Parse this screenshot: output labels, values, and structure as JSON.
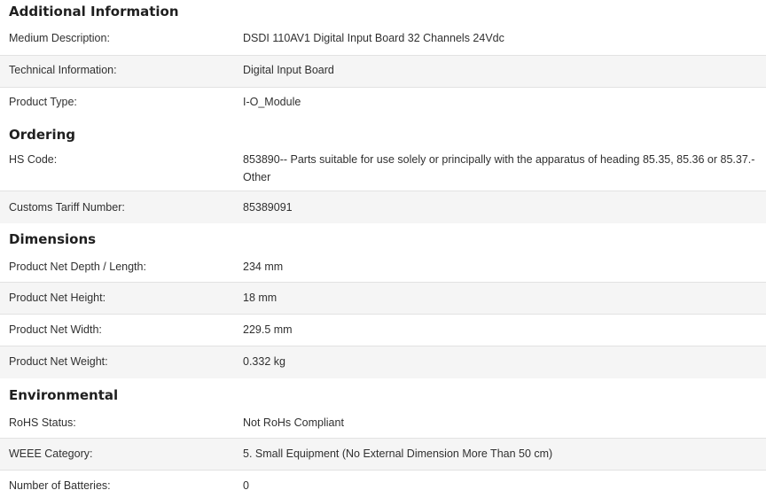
{
  "sections": [
    {
      "title": "Additional Information",
      "rows": [
        {
          "label": "Medium Description:",
          "value": "DSDI 110AV1 Digital Input Board 32 Channels 24Vdc"
        },
        {
          "label": "Technical Information:",
          "value": "Digital Input Board"
        },
        {
          "label": "Product Type:",
          "value": "I-O_Module"
        }
      ]
    },
    {
      "title": "Ordering",
      "rows": [
        {
          "label": "HS Code:",
          "value": "853890-- Parts suitable for use solely or principally with the apparatus of heading 85.35, 85.36 or 85.37.- Other"
        },
        {
          "label": "Customs Tariff Number:",
          "value": "85389091"
        }
      ]
    },
    {
      "title": "Dimensions",
      "rows": [
        {
          "label": "Product Net Depth / Length:",
          "value": "234 mm"
        },
        {
          "label": "Product Net Height:",
          "value": "18 mm"
        },
        {
          "label": "Product Net Width:",
          "value": "229.5 mm"
        },
        {
          "label": "Product Net Weight:",
          "value": "0.332 kg"
        }
      ]
    },
    {
      "title": "Environmental",
      "rows": [
        {
          "label": "RoHS Status:",
          "value": "Not RoHs Compliant"
        },
        {
          "label": "WEEE Category:",
          "value": "5. Small Equipment (No External Dimension More Than 50 cm)"
        },
        {
          "label": "Number of Batteries:",
          "value": "0"
        }
      ]
    }
  ]
}
